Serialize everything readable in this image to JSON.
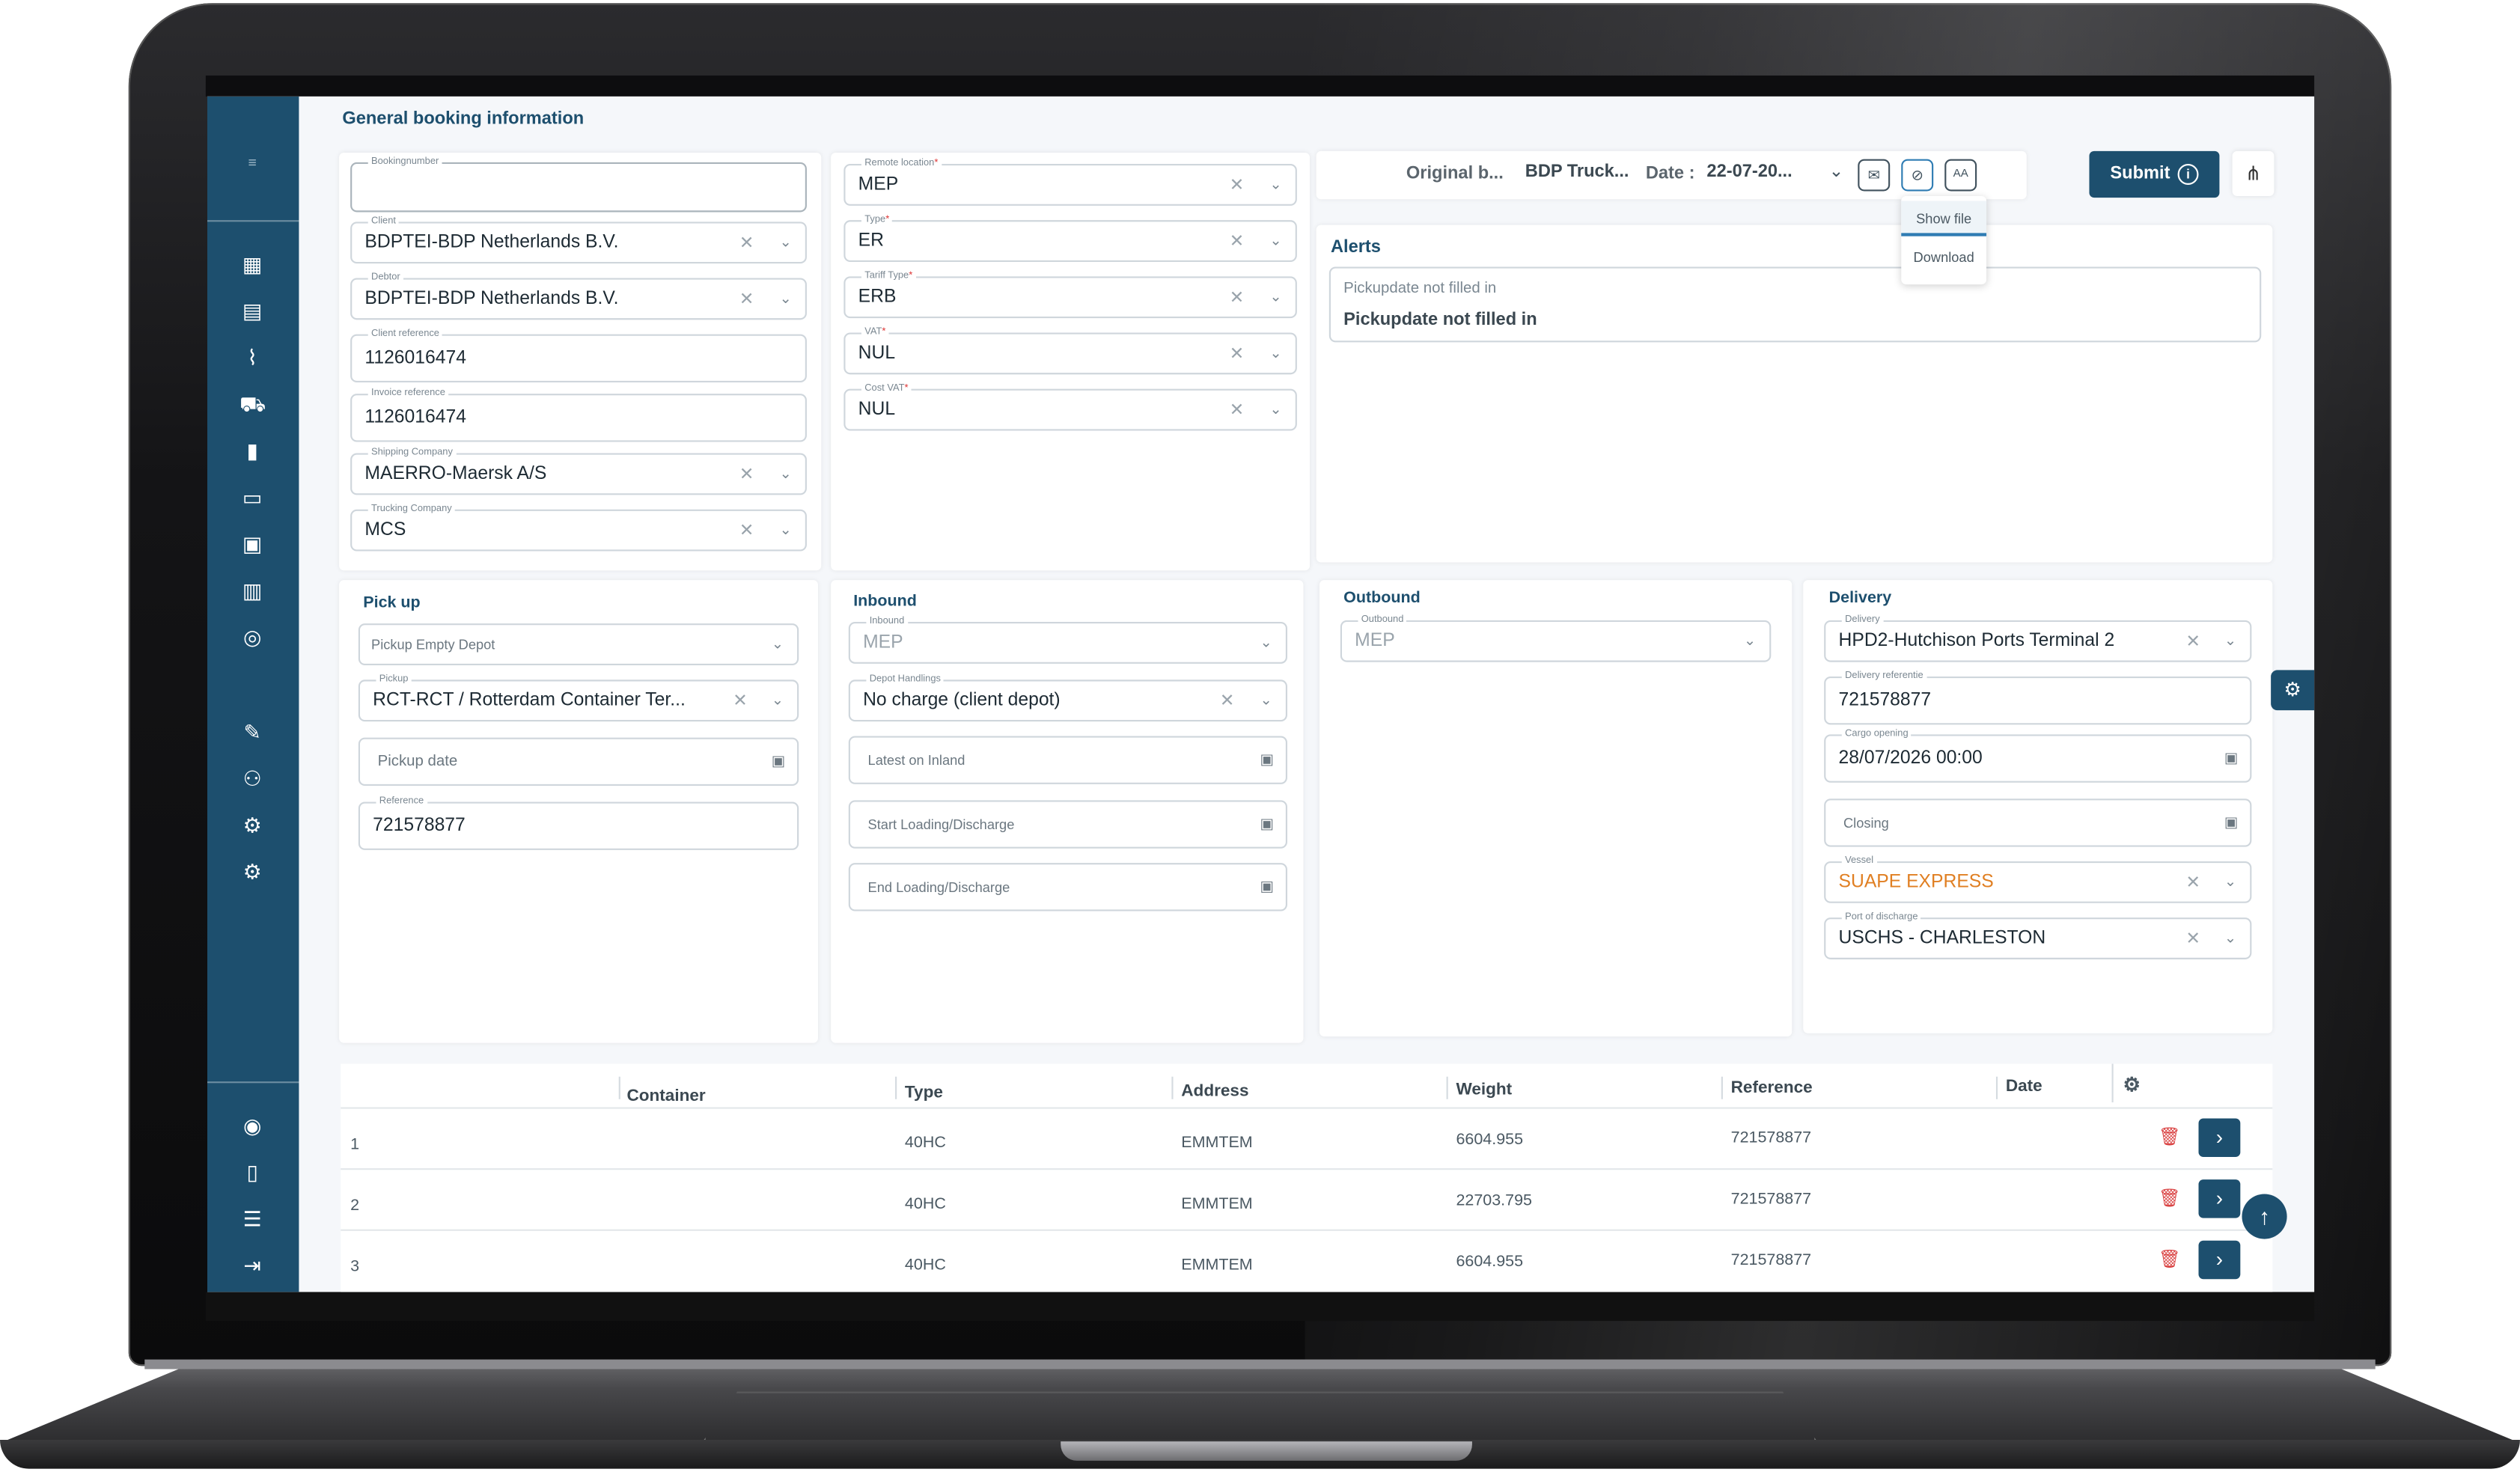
{
  "page_title": "General booking information",
  "booking": {
    "bookingnumber": {
      "label": "Bookingnumber",
      "value": ""
    },
    "client": {
      "label": "Client",
      "value": "BDPTEI-BDP Netherlands B.V."
    },
    "debtor": {
      "label": "Debtor",
      "value": "BDPTEI-BDP Netherlands B.V."
    },
    "client_reference": {
      "label": "Client reference",
      "value": "1126016474"
    },
    "invoice_reference": {
      "label": "Invoice reference",
      "value": "1126016474"
    },
    "shipping_company": {
      "label": "Shipping Company",
      "value": "MAERRO-Maersk A/S"
    },
    "trucking_company": {
      "label": "Trucking Company",
      "value": "MCS"
    }
  },
  "remote": {
    "remote_location": {
      "label": "Remote location",
      "value": "MEP"
    },
    "type": {
      "label": "Type",
      "value": "ER"
    },
    "tariff_type": {
      "label": "Tariff Type",
      "value": "ERB"
    },
    "vat": {
      "label": "VAT",
      "value": "NUL"
    },
    "cost_vat": {
      "label": "Cost VAT",
      "value": "NUL"
    }
  },
  "toolbar": {
    "original": "Original b...",
    "company": "BDP Truck...",
    "date_label": "Date :",
    "date_value": "22-07-20...",
    "submit": "Submit",
    "menu_options": [
      "Show file",
      "Download"
    ]
  },
  "alerts": {
    "title": "Alerts",
    "small": "Pickupdate not filled in",
    "big": "Pickupdate not filled in"
  },
  "pickup": {
    "title": "Pick up",
    "depot_placeholder": "Pickup Empty Depot",
    "pickup": {
      "label": "Pickup",
      "value": "RCT-RCT / Rotterdam Container Ter..."
    },
    "date_placeholder": "Pickup date",
    "reference": {
      "label": "Reference",
      "value": "721578877"
    }
  },
  "inbound": {
    "title": "Inbound",
    "inbound": {
      "label": "Inbound",
      "value": "MEP"
    },
    "depot_handlings": {
      "label": "Depot Handlings",
      "value": "No charge (client depot)"
    },
    "latest_placeholder": "Latest on Inland",
    "start_placeholder": "Start Loading/Discharge",
    "end_placeholder": "End Loading/Discharge"
  },
  "outbound": {
    "title": "Outbound",
    "outbound": {
      "label": "Outbound",
      "value": "MEP"
    }
  },
  "delivery": {
    "title": "Delivery",
    "delivery": {
      "label": "Delivery",
      "value": "HPD2-Hutchison Ports Terminal 2"
    },
    "delivery_ref": {
      "label": "Delivery referentie",
      "value": "721578877"
    },
    "cargo_opening": {
      "label": "Cargo opening",
      "value": "28/07/2026 00:00"
    },
    "closing_placeholder": "Closing",
    "vessel": {
      "label": "Vessel",
      "value": "SUAPE EXPRESS"
    },
    "port_discharge": {
      "label": "Port of discharge",
      "value": "USCHS - CHARLESTON"
    }
  },
  "table": {
    "headers": [
      "Container",
      "Type",
      "Address",
      "Weight",
      "Reference",
      "Date"
    ],
    "rows": [
      {
        "no": "1",
        "type": "40HC",
        "address": "EMMTEM",
        "weight": "6604.955",
        "reference": "721578877"
      },
      {
        "no": "2",
        "type": "40HC",
        "address": "EMMTEM",
        "weight": "22703.795",
        "reference": "721578877"
      },
      {
        "no": "3",
        "type": "40HC",
        "address": "EMMTEM",
        "weight": "6604.955",
        "reference": "721578877"
      }
    ]
  },
  "colors": {
    "primary": "#1d4f6e",
    "accent_orange": "#e07f22",
    "danger": "#d94040"
  }
}
